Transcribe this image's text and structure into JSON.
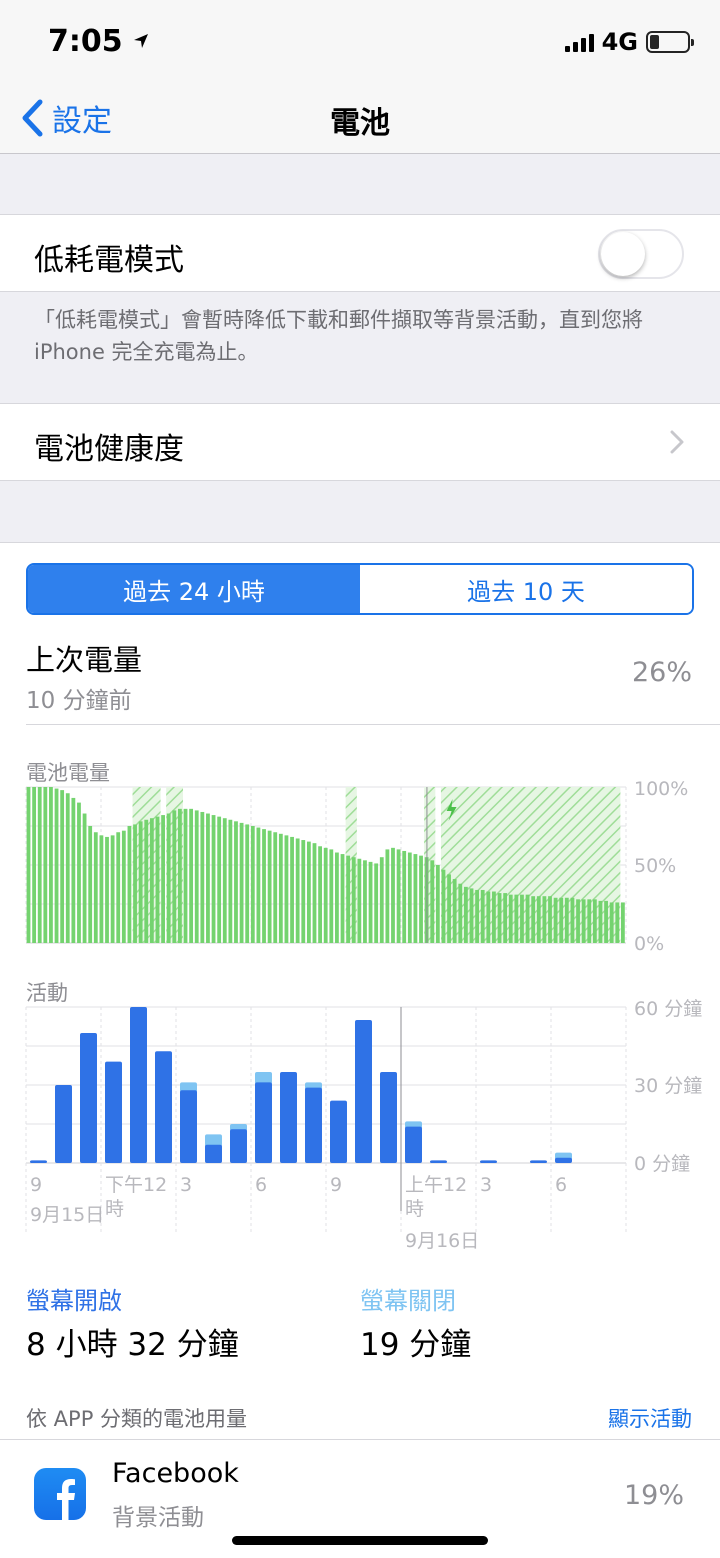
{
  "status_bar": {
    "time": "7:05",
    "network": "4G",
    "battery_level": 0.26
  },
  "nav": {
    "back_label": "設定",
    "title": "電池"
  },
  "low_power": {
    "label": "低耗電模式",
    "enabled": false,
    "footer": "「低耗電模式」會暫時降低下載和郵件擷取等背景活動，直到您將 iPhone 完全充電為止。"
  },
  "battery_health": {
    "label": "電池健康度"
  },
  "tabs": [
    {
      "label": "過去 24 小時",
      "active": true
    },
    {
      "label": "過去 10 天",
      "active": false
    }
  ],
  "last_charge": {
    "title": "上次電量",
    "subtitle": "10 分鐘前",
    "value": "26%"
  },
  "colors": {
    "accent": "#1a73e8",
    "battery_green": "#74d36f",
    "screen_on": "#2f72e6",
    "screen_off": "#7fc4f2"
  },
  "chart_data": [
    {
      "type": "bar",
      "title": "電池電量",
      "y_ticks": [
        "100%",
        "50%",
        "0%"
      ],
      "ylim": [
        0,
        100
      ],
      "levels": [
        100,
        100,
        100,
        100,
        100,
        99,
        98,
        96,
        93,
        90,
        83,
        75,
        71,
        69,
        68,
        69,
        71,
        72,
        75,
        76,
        78,
        79,
        80,
        81,
        82,
        83,
        85,
        86,
        86,
        86,
        85,
        84,
        83,
        82,
        81,
        80,
        79,
        78,
        77,
        76,
        75,
        74,
        73,
        72,
        71,
        70,
        69,
        68,
        67,
        66,
        65,
        64,
        62,
        61,
        60,
        58,
        57,
        56,
        55,
        54,
        53,
        52,
        51,
        55,
        60,
        61,
        60,
        59,
        58,
        57,
        56,
        55,
        53,
        50,
        47,
        44,
        41,
        38,
        36,
        35,
        34,
        34,
        33,
        33,
        32,
        32,
        31,
        31,
        31,
        31,
        30,
        30,
        30,
        30,
        29,
        29,
        29,
        29,
        28,
        28,
        28,
        28,
        27,
        27,
        26,
        26,
        26
      ],
      "charging_spans": [
        [
          19,
          24
        ],
        [
          25,
          28
        ],
        [
          57,
          59
        ],
        [
          71,
          73
        ],
        [
          74,
          106
        ]
      ]
    },
    {
      "type": "bar",
      "title": "活動",
      "y_ticks": [
        "60 分鐘",
        "30 分鐘",
        "0 分鐘"
      ],
      "ylim": [
        0,
        60
      ],
      "x_ticks": [
        "9",
        "下午12時",
        "3",
        "6",
        "9",
        "上午12時",
        "3",
        "6"
      ],
      "dates": [
        "9月15日",
        "9月16日"
      ],
      "series": [
        {
          "name": "螢幕開啟",
          "values": [
            1,
            30,
            50,
            39,
            60,
            43,
            28,
            7,
            13,
            31,
            35,
            29,
            24,
            55,
            35,
            14,
            1,
            0,
            1,
            0,
            1,
            2
          ]
        },
        {
          "name": "螢幕關閉",
          "values": [
            0,
            0,
            0,
            0,
            0,
            0,
            3,
            4,
            2,
            4,
            0,
            2,
            0,
            0,
            0,
            2,
            0,
            0,
            0,
            0,
            0,
            2
          ]
        }
      ]
    }
  ],
  "screen_stats": {
    "on_label": "螢幕開啟",
    "on_value": "8 小時 32 分鐘",
    "off_label": "螢幕關閉",
    "off_value": "19 分鐘"
  },
  "app_section": {
    "caption": "依 APP 分類的電池用量",
    "action": "顯示活動"
  },
  "apps": [
    {
      "name": "Facebook",
      "subtitle": "背景活動",
      "value": "19%",
      "icon": "facebook-icon"
    }
  ]
}
